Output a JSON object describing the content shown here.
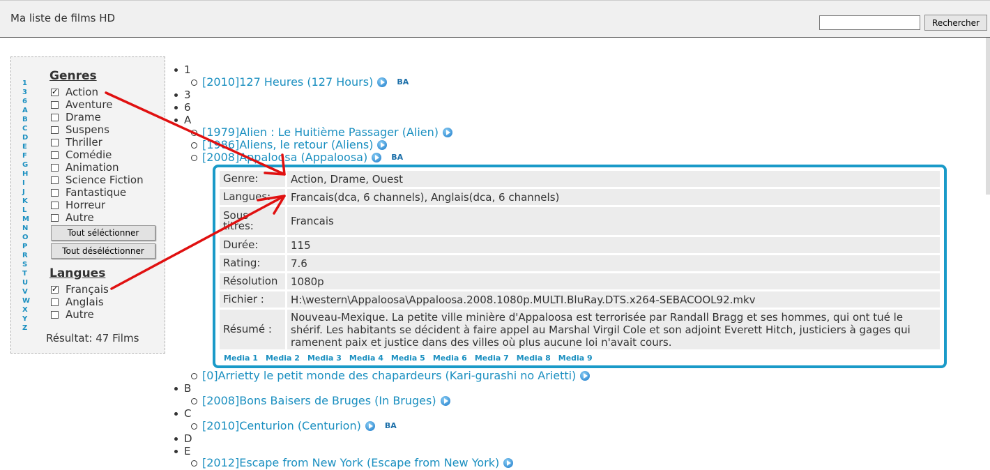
{
  "header": {
    "title": "Ma liste de films HD",
    "search_button": "Rechercher",
    "search_value": ""
  },
  "sidebar": {
    "alpha_index": [
      "1",
      "3",
      "6",
      "A",
      "B",
      "C",
      "D",
      "E",
      "F",
      "G",
      "H",
      "I",
      "J",
      "K",
      "L",
      "M",
      "N",
      "O",
      "P",
      "R",
      "S",
      "T",
      "U",
      "V",
      "W",
      "X",
      "Y",
      "Z"
    ],
    "genres_heading": "Genres",
    "genres": [
      {
        "label": "Action",
        "checked": true
      },
      {
        "label": "Aventure",
        "checked": false
      },
      {
        "label": "Drame",
        "checked": false
      },
      {
        "label": "Suspens",
        "checked": false
      },
      {
        "label": "Thriller",
        "checked": false
      },
      {
        "label": "Comédie",
        "checked": false
      },
      {
        "label": "Animation",
        "checked": false
      },
      {
        "label": "Science Fiction",
        "checked": false
      },
      {
        "label": "Fantastique",
        "checked": false
      },
      {
        "label": "Horreur",
        "checked": false
      },
      {
        "label": "Autre",
        "checked": false
      }
    ],
    "select_all": "Tout séléctionner",
    "deselect_all": "Tout déséléctionner",
    "langues_heading": "Langues",
    "langues": [
      {
        "label": "Français",
        "checked": true
      },
      {
        "label": "Anglais",
        "checked": false
      },
      {
        "label": "Autre",
        "checked": false
      }
    ],
    "result": "Résultat: 47 Films"
  },
  "letters": [
    "1",
    "3",
    "6",
    "A",
    "B",
    "C",
    "D",
    "E"
  ],
  "films": [
    {
      "title": "[2010]127 Heures (127 Hours)",
      "ba": "BA"
    },
    {
      "title": "[1979]Alien : Le Huitième Passager (Alien)",
      "ba": ""
    },
    {
      "title": "[1986]Aliens, le retour (Aliens)",
      "ba": ""
    },
    {
      "title": "[2008]Appaloosa (Appaloosa)",
      "ba": "BA"
    },
    {
      "title": "[0]Arrietty le petit monde des chapardeurs (Kari-gurashi no Arietti)",
      "ba": ""
    },
    {
      "title": "[2008]Bons Baisers de Bruges (In Bruges)",
      "ba": ""
    },
    {
      "title": "[2010]Centurion (Centurion)",
      "ba": "BA"
    },
    {
      "title": "[2012]Escape from New York (Escape from New York)",
      "ba": ""
    }
  ],
  "detail": {
    "genre_label": "Genre:",
    "genre": "Action,  Drame,  Ouest",
    "langues_label": "Langues:",
    "langues": "Francais(dca, 6 channels),  Anglais(dca, 6 channels)",
    "sous_titres_label": "Sous titres:",
    "sous_titres": "Francais",
    "duree_label": "Durée:",
    "duree": "115",
    "rating_label": "Rating:",
    "rating": "7.6",
    "resolution_label": "Résolution",
    "resolution": "1080p",
    "fichier_label": "Fichier :",
    "fichier": "H:\\western\\Appaloosa\\Appaloosa.2008.1080p.MULTI.BluRay.DTS.x264-SEBACOOL92.mkv",
    "resume_label": "Résumé :",
    "resume": "Nouveau-Mexique. La petite ville minière d'Appaloosa est terrorisée par Randall Bragg et ses hommes, qui ont tué le shérif. Les habitants se décident à faire appel au Marshal Virgil Cole et son adjoint Everett Hitch, justiciers à gages qui ramenent paix et justice dans des villes où plus aucune loi n'avait cours.",
    "media": [
      "Media 1",
      "Media 2",
      "Media 3",
      "Media 4",
      "Media 5",
      "Media 6",
      "Media 7",
      "Media 8",
      "Media 9"
    ]
  },
  "colors": {
    "link": "#1a8fc0",
    "card_border": "#1a9ac8",
    "annotation_arrow": "#e01010"
  }
}
